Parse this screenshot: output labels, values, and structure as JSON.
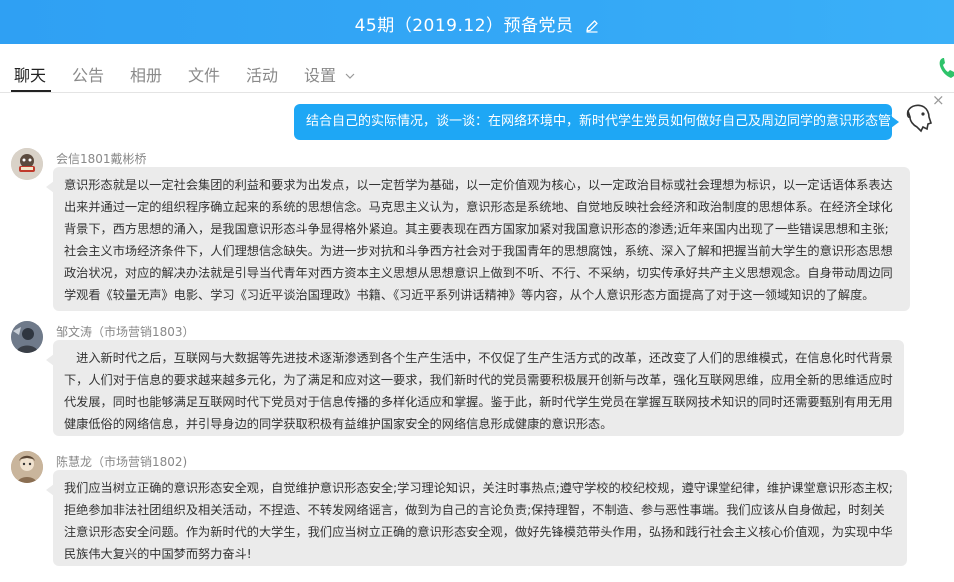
{
  "window": {
    "title": "45期（2019.12）预备党员",
    "edit_icon": "pencil-icon"
  },
  "tabs": [
    {
      "label": "聊天",
      "active": true
    },
    {
      "label": "公告"
    },
    {
      "label": "相册"
    },
    {
      "label": "文件"
    },
    {
      "label": "活动"
    },
    {
      "label": "设置"
    }
  ],
  "icons": {
    "settings_caret": "chevron-down-icon",
    "phone": "phone-icon",
    "close": "close-icon"
  },
  "colors": {
    "title_bar": "#34a8f6",
    "my_bubble": "#1ea7f5",
    "other_bubble": "#ebebeb",
    "phone": "#2ec36a"
  },
  "chat": {
    "close_label": "×",
    "my_message": {
      "text": "结合自己的实际情况，谈一谈：在网络环境中，新时代学生党员如何做好自己及周边同学的意识形态管理等。"
    },
    "messages": [
      {
        "sender": "会信1801戴彬桥",
        "text": "意识形态就是以一定社会集团的利益和要求为出发点，以一定哲学为基础，以一定价值观为核心，以一定政治目标或社会理想为标识，以一定话语体系表达出来并通过一定的组织程序确立起来的系统的思想信念。马克思主义认为，意识形态是系统地、自觉地反映社会经济和政治制度的思想体系。在经济全球化背景下，西方思想的涌入，是我国意识形态斗争显得格外紧迫。其主要表现在西方国家加紧对我国意识形态的渗透;近年来国内出现了一些错误思想和主张;社会主义市场经济条件下，人们理想信念缺失。为进一步对抗和斗争西方社会对于我国青年的思想腐蚀，系统、深入了解和把握当前大学生的意识形态思想政治状况，对应的解决办法就是引导当代青年对西方资本主义思想从思想意识上做到不听、不行、不采纳，切实传承好共产主义思想观念。自身带动周边同学观看《较量无声》电影、学习《习近平谈治国理政》书籍、《习近平系列讲话精神》等内容，从个人意识形态方面提高了对于这一领域知识的了解度。"
      },
      {
        "sender": "邹文涛（市场营销1803）",
        "text": "　进入新时代之后，互联网与大数据等先进技术逐渐渗透到各个生产生活中，不仅促了生产生活方式的改革，还改变了人们的思维模式，在信息化时代背景下，人们对于信息的要求越来越多元化，为了满足和应对这一要求，我们新时代的党员需要积极展开创新与改革，强化互联网思维，应用全新的思维适应时代发展，同时也能够满足互联网时代下党员对于信息传播的多样化适应和掌握。鉴于此，新时代学生党员在掌握互联网技术知识的同时还需要甄别有用无用健康低俗的网络信息，并引导身边的同学获取积极有益维护国家安全的网络信息形成健康的意识形态。"
      },
      {
        "sender": "陈慧龙（市场营销1802)",
        "text": "我们应当树立正确的意识形态安全观，自觉维护意识形态安全;学习理论知识，关注时事热点;遵守学校的校纪校规，遵守课堂纪律，维护课堂意识形态主权;拒绝参加非法社团组织及相关活动，不捏造、不转发网络谣言，做到为自己的言论负责;保持理智，不制造、参与恶性事端。我们应该从自身做起，时刻关注意识形态安全问题。作为新时代的大学生，我们应当树立正确的意识形态安全观，做好先锋模范带头作用，弘扬和践行社会主义核心价值观，为实现中华民族伟大复兴的中国梦而努力奋斗!"
      }
    ]
  }
}
